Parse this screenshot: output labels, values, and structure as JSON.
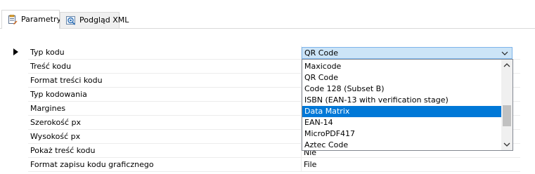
{
  "tabs": [
    {
      "label": "Parametry",
      "icon": "properties-icon",
      "active": true
    },
    {
      "label": "Podgląd XML",
      "icon": "preview-icon",
      "active": false
    }
  ],
  "grid": {
    "rows": [
      {
        "name": "Typ kodu",
        "value": ""
      },
      {
        "name": "Treść kodu",
        "value": ""
      },
      {
        "name": "Format treści kodu",
        "value": ""
      },
      {
        "name": "Typ kodowania",
        "value": ""
      },
      {
        "name": "Margines",
        "value": ""
      },
      {
        "name": "Szerokość px",
        "value": ""
      },
      {
        "name": "Wysokość px",
        "value": ""
      },
      {
        "name": "Pokaż treść kodu",
        "value": "Nie"
      },
      {
        "name": "Format zapisu kodu graficznego",
        "value": "File"
      }
    ]
  },
  "combo": {
    "value": "QR Code",
    "icon": "chevron-down-icon"
  },
  "dropdown": {
    "options": [
      "Maxicode",
      "QR Code",
      "Code 128 (Subset B)",
      "ISBN (EAN-13 with verification stage)",
      "Data Matrix",
      "EAN-14",
      "MicroPDF417",
      "Aztec Code"
    ],
    "selected": "Data Matrix",
    "scroll_up_icon": "chevron-up-icon",
    "scroll_down_icon": "chevron-down-icon"
  },
  "colors": {
    "selection": "#0078d7",
    "combo_bg": "#cce4f7",
    "combo_border": "#7eb4ea"
  }
}
